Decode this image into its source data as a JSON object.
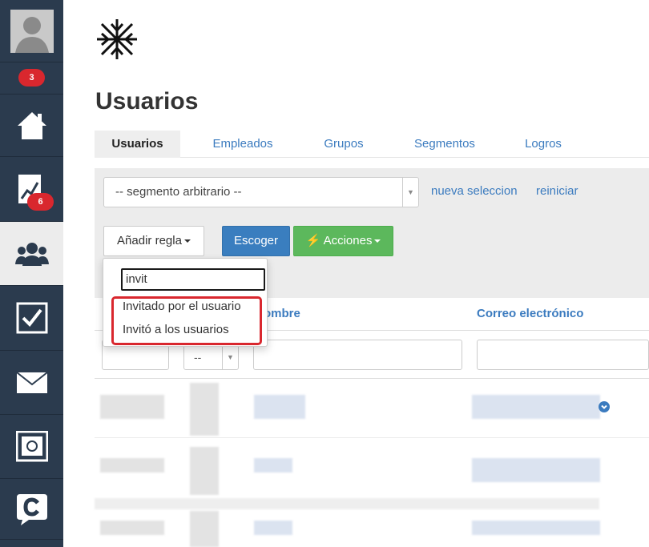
{
  "sidebar": {
    "items": [
      {
        "icon": "user-avatar-icon"
      },
      {
        "badge": "3"
      },
      {
        "icon": "home-icon"
      },
      {
        "icon": "chart-up-icon",
        "badge": "6"
      },
      {
        "icon": "users-group-icon",
        "active": true
      },
      {
        "icon": "checkbox-icon"
      },
      {
        "icon": "envelope-icon"
      },
      {
        "icon": "safe-icon"
      },
      {
        "icon": "chat-c-icon"
      }
    ],
    "colors": {
      "bg": "#2b3b4e",
      "active_bg": "#ececec",
      "badge": "#d9272e"
    }
  },
  "logo": {
    "icon": "snowflake-arrows-logo"
  },
  "page": {
    "title": "Usuarios"
  },
  "tabs": [
    {
      "label": "Usuarios",
      "active": true
    },
    {
      "label": "Empleados"
    },
    {
      "label": "Grupos"
    },
    {
      "label": "Segmentos"
    },
    {
      "label": "Logros"
    }
  ],
  "filters": {
    "segment_select": "-- segmento arbitrario --",
    "new_selection": "nueva seleccion",
    "reset": "reiniciar",
    "add_rule": "Añadir regla",
    "choose": "Escoger",
    "actions": "Acciones"
  },
  "dropdown": {
    "search_value": "invit",
    "options": [
      "Invitado por el usuario",
      "Invitó a los usuarios"
    ],
    "highlight_color": "#d9272e"
  },
  "table": {
    "headers": [
      "ombre",
      "Correo electrónico"
    ],
    "filter_select": "--"
  },
  "colors": {
    "link": "#3b7bbf",
    "primary": "#3a7ebf",
    "success": "#5cb85c"
  }
}
